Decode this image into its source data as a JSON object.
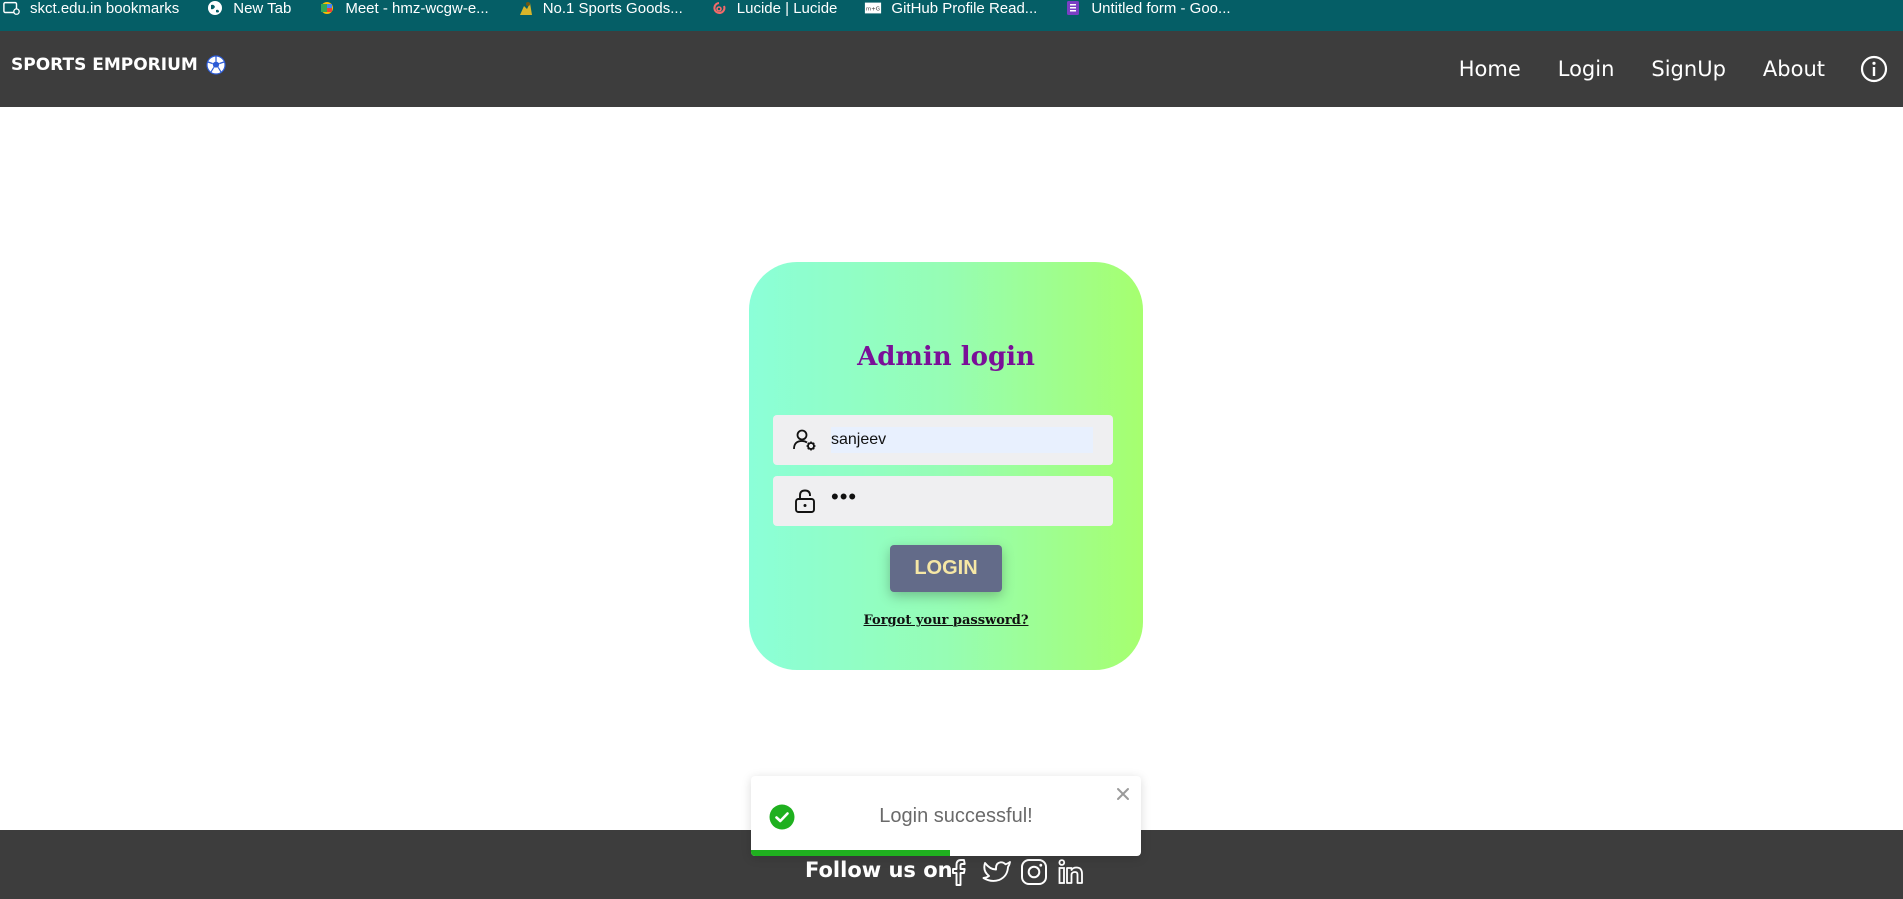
{
  "bookmarks": [
    {
      "label": "skct.edu.in bookmarks",
      "icon": "bookmark-folder-icon"
    },
    {
      "label": "New Tab",
      "icon": "globe-icon"
    },
    {
      "label": "Meet - hmz-wcgw-e...",
      "icon": "meet-icon"
    },
    {
      "label": "No.1 Sports Goods...",
      "icon": "sports-icon"
    },
    {
      "label": "Lucide | Lucide",
      "icon": "lucide-icon"
    },
    {
      "label": "GitHub Profile Read...",
      "icon": "github-readme-icon"
    },
    {
      "label": "Untitled form - Goo...",
      "icon": "forms-icon"
    }
  ],
  "navbar": {
    "brand": "SPORTS EMPORIUM",
    "links": [
      "Home",
      "Login",
      "SignUp",
      "About"
    ]
  },
  "login": {
    "title": "Admin login",
    "username_value": "sanjeev",
    "password_value": "•••",
    "button_label": "LOGIN",
    "forgot_label": "Forgot your password?"
  },
  "footer": {
    "follow_label": "Follow us on",
    "socials": [
      "facebook-icon",
      "twitter-icon",
      "instagram-icon",
      "linkedin-icon"
    ]
  },
  "toast": {
    "message": "Login successful!",
    "progress": 0.51
  },
  "colors": {
    "bookmarks_bg": "#055e66",
    "navbar_bg": "#3d3d3d",
    "title": "#7a0f98",
    "button_bg": "#636b89",
    "button_text": "#f6e7a5",
    "success": "#1fb01f"
  }
}
